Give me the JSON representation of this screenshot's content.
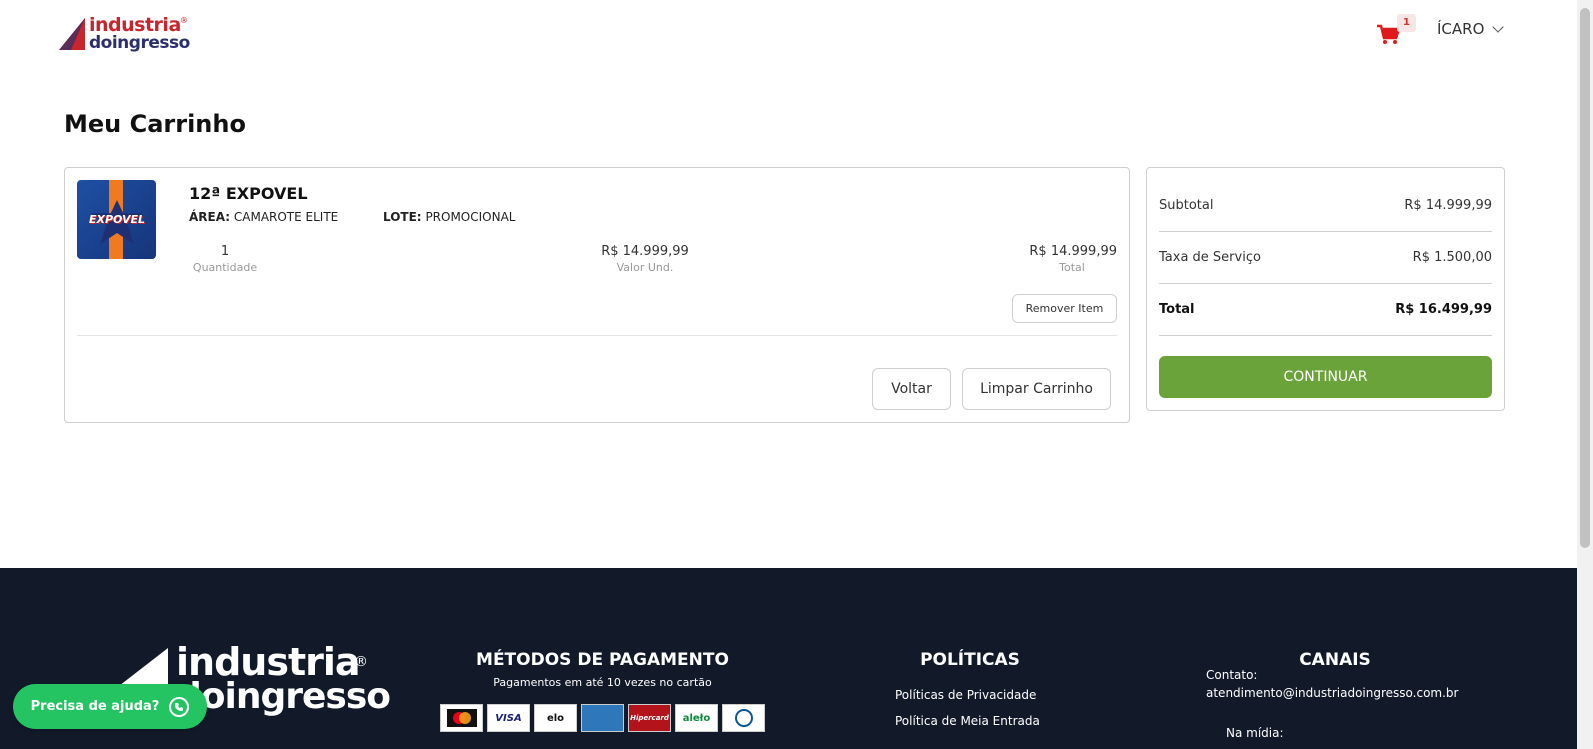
{
  "header": {
    "logo_line1": "industria",
    "logo_line2": "doingresso",
    "logo_reg": "®",
    "cart_count": "1",
    "user_name": "ÍCARO"
  },
  "page": {
    "title": "Meu Carrinho"
  },
  "cart_item": {
    "event_image_text": "EXPOVEL",
    "event_title": "12ª EXPOVEL",
    "area_label": "ÁREA:",
    "area_value": "CAMAROTE ELITE",
    "lote_label": "LOTE:",
    "lote_value": "PROMOCIONAL",
    "quantity": "1",
    "quantity_label": "Quantidade",
    "unit_price": "R$ 14.999,99",
    "unit_price_label": "Valor Und.",
    "total": "R$ 14.999,99",
    "total_label": "Total",
    "remove_label": "Remover Item"
  },
  "cart_actions": {
    "back_label": "Voltar",
    "clear_label": "Limpar Carrinho"
  },
  "summary": {
    "subtotal_label": "Subtotal",
    "subtotal_value": "R$ 14.999,99",
    "fee_label": "Taxa de Serviço",
    "fee_value": "R$ 1.500,00",
    "total_label": "Total",
    "total_value": "R$ 16.499,99",
    "continue_label": "CONTINUAR"
  },
  "footer": {
    "logo_line1": "industria",
    "logo_line2": "doingresso",
    "logo_reg": "®",
    "payment_title": "MÉTODOS DE PAGAMENTO",
    "payment_subtitle": "Pagamentos em até 10 vezes no cartão",
    "cards": [
      "",
      "VISA",
      "elo",
      "",
      "Hipercard",
      "aleło",
      ""
    ],
    "policies_title": "POLÍTICAS",
    "policy_links": [
      "Políticas de Privacidade",
      "Política de Meia Entrada"
    ],
    "channels_title": "CANAIS",
    "contact_label": "Contato:",
    "contact_email": "atendimento@industriadoingresso.com.br",
    "media_label": "Na mídia:"
  },
  "help_button": {
    "label": "Precisa de ajuda?"
  },
  "colors": {
    "accent_green": "#6aa33a",
    "brand_red": "#c8252d",
    "footer_bg": "#121a2a",
    "whatsapp_green": "#25c463"
  }
}
